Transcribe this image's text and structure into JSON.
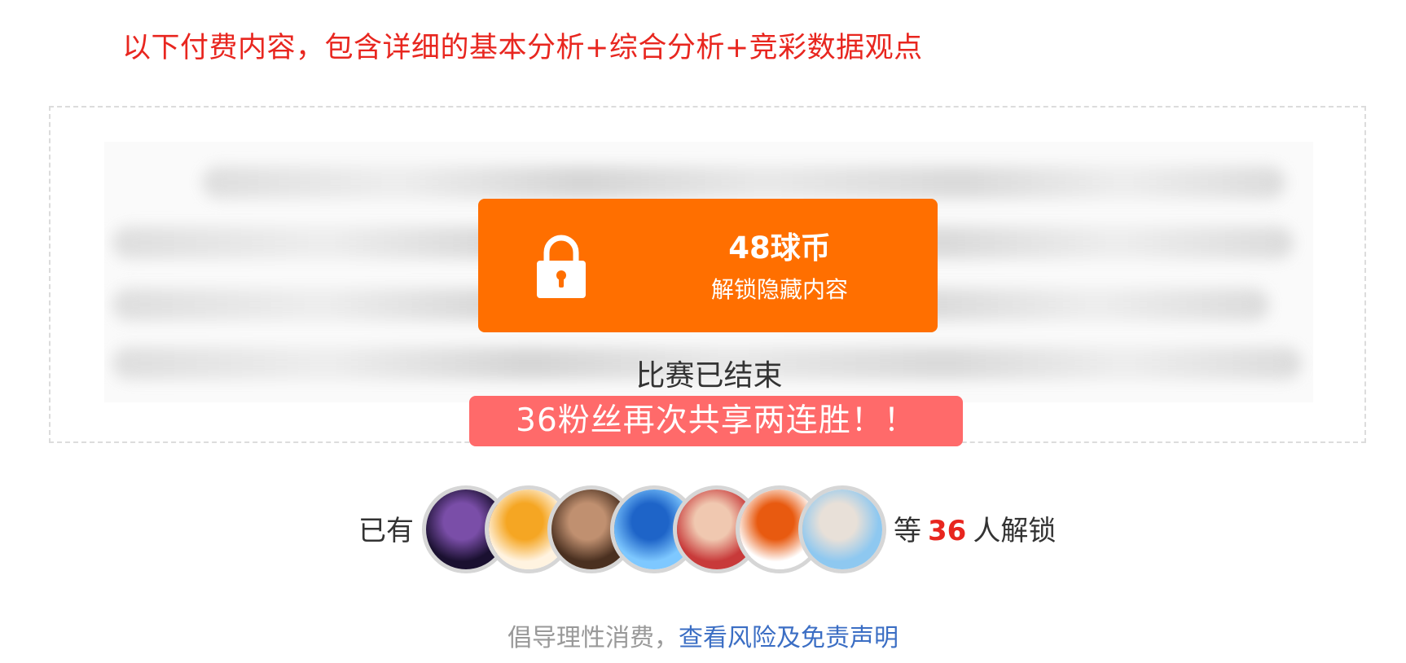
{
  "notice": "以下付费内容，包含详细的基本分析+综合分析+竞彩数据观点",
  "unlock": {
    "price": "48球币",
    "label": "解锁隐藏内容"
  },
  "status": "比赛已结束",
  "promo": "36粉丝再次共享两连胜！！",
  "unlocked": {
    "prefix": "已有",
    "suffix_before": "等",
    "count": "36",
    "suffix_after": "人解锁",
    "avatars": [
      {
        "name": "night-city-lights",
        "colors": [
          "#1a1030",
          "#7a4ea8"
        ]
      },
      {
        "name": "cartoon-badge",
        "colors": [
          "#fff3e0",
          "#f5a623"
        ]
      },
      {
        "name": "wrestler",
        "colors": [
          "#4a3020",
          "#c09070"
        ]
      },
      {
        "name": "donald-duck",
        "colors": [
          "#7ec8ff",
          "#1e64c8"
        ]
      },
      {
        "name": "boy-red-background",
        "colors": [
          "#c83a3a",
          "#f0c8b0"
        ]
      },
      {
        "name": "autumn-leaves",
        "colors": [
          "#ffffff",
          "#e85a10"
        ]
      },
      {
        "name": "woman-outdoors",
        "colors": [
          "#8ec8f0",
          "#e8e0d8"
        ]
      }
    ]
  },
  "disclaimer": {
    "text": "倡导理性消费，",
    "link": "查看风险及免责声明"
  },
  "colors": {
    "accent_orange": "#ff6f00",
    "promo_red": "#ff6a6a",
    "notice_red": "#e8261f",
    "link_blue": "#3b6ec4"
  }
}
